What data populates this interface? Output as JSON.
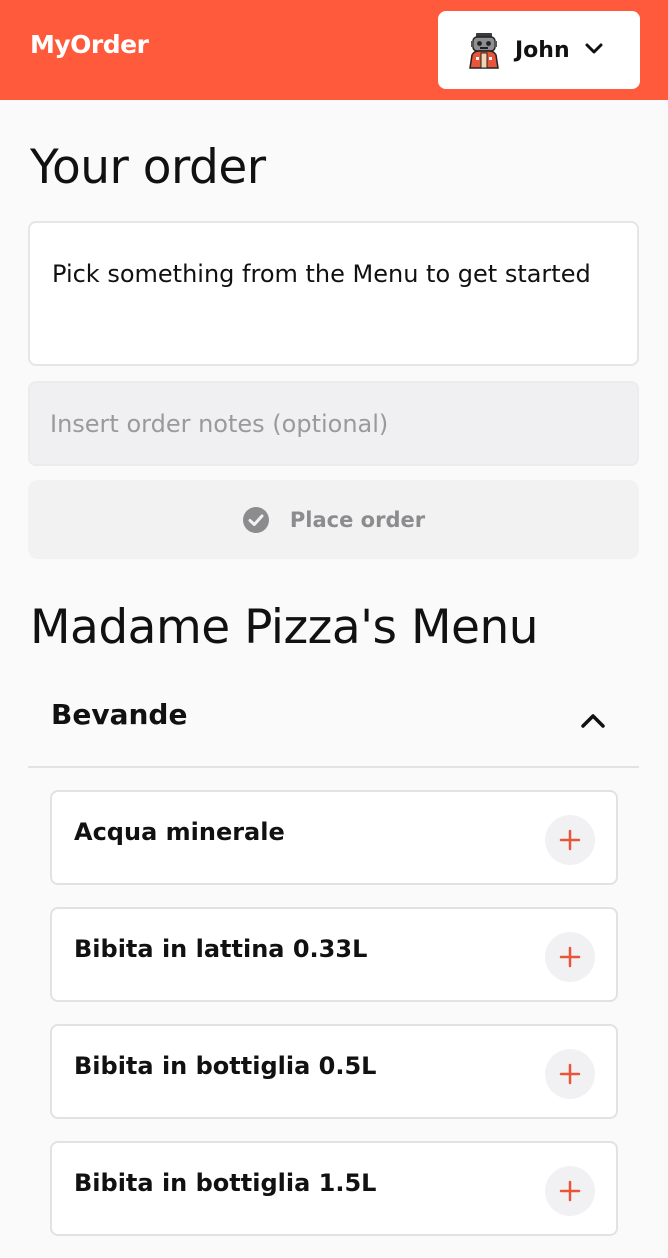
{
  "header": {
    "brand": "MyOrder",
    "user_name": "John",
    "avatar_icon": "robot-avatar-icon",
    "brand_color": "#ff5a3c"
  },
  "order": {
    "title": "Your order",
    "empty_message": "Pick something from the Menu to get started",
    "notes_placeholder": "Insert order notes (optional)",
    "place_order_label": "Place order",
    "place_order_icon": "check-circle-icon"
  },
  "menu": {
    "title": "Madame Pizza's Menu",
    "categories": [
      {
        "name": "Bevande",
        "expanded_icon": "chevron-up-icon",
        "items": [
          {
            "name": "Acqua minerale",
            "add_icon": "plus-icon"
          },
          {
            "name": "Bibita in lattina 0.33L",
            "add_icon": "plus-icon"
          },
          {
            "name": "Bibita in bottiglia 0.5L",
            "add_icon": "plus-icon"
          },
          {
            "name": "Bibita in bottiglia 1.5L",
            "add_icon": "plus-icon"
          }
        ]
      }
    ]
  },
  "colors": {
    "accent": "#ff5a3c",
    "add_icon": "#e8553a",
    "disabled_text": "#8c8c8e"
  }
}
